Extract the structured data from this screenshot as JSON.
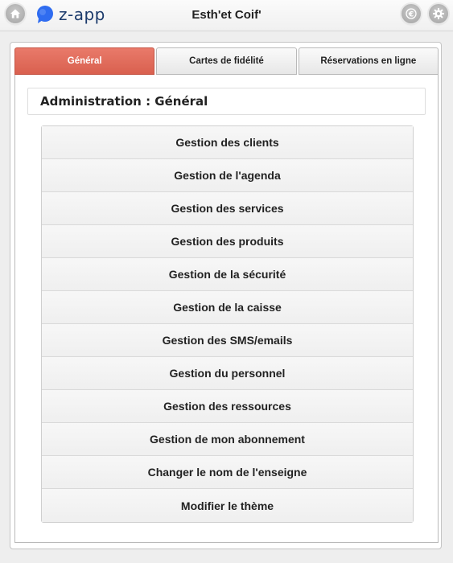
{
  "header": {
    "logo_text": "z-app",
    "title": "Esth'et Coif'",
    "icons": [
      "home-icon",
      "euro-icon",
      "settings-icon"
    ]
  },
  "tabs": [
    {
      "label": "Général",
      "active": true
    },
    {
      "label": "Cartes de fidélité",
      "active": false
    },
    {
      "label": "Réservations en ligne",
      "active": false
    }
  ],
  "section": {
    "title": "Administration : Général"
  },
  "menu": {
    "items": [
      "Gestion des clients",
      "Gestion de l'agenda",
      "Gestion des services",
      "Gestion des produits",
      "Gestion de la sécurité",
      "Gestion de la caisse",
      "Gestion des SMS/emails",
      "Gestion du personnel",
      "Gestion des ressources",
      "Gestion de mon abonnement",
      "Changer le nom de l'enseigne",
      "Modifier le thème"
    ]
  },
  "colors": {
    "active_tab": "#e0695a",
    "logo_blue": "#2f6cf0",
    "logo_text": "#1b3a6b"
  }
}
